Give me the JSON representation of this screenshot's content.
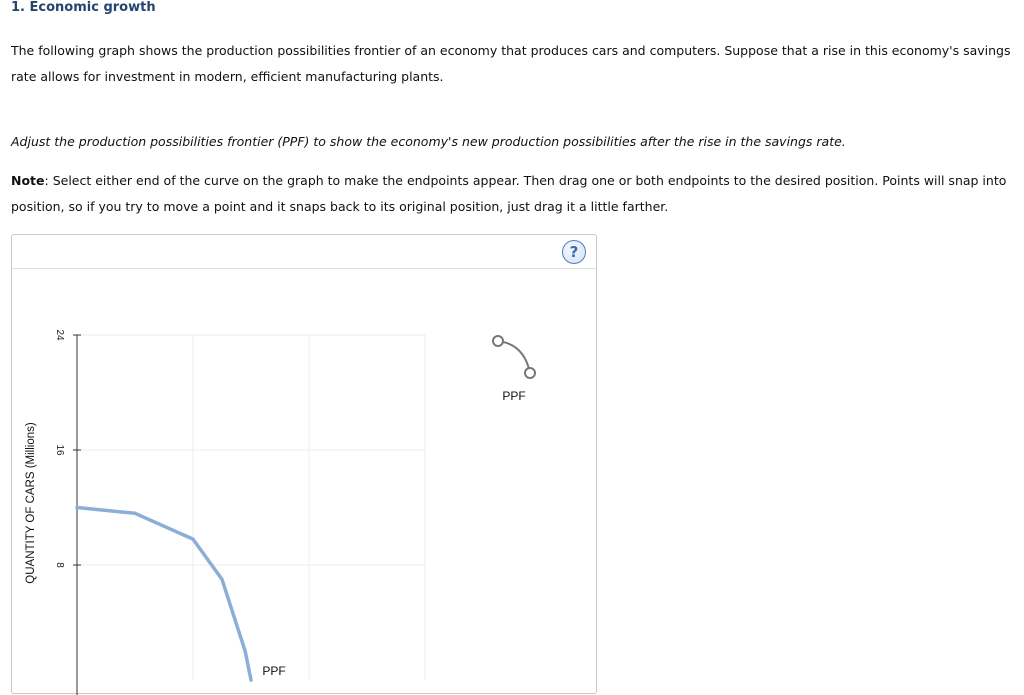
{
  "question": {
    "title": "1. Economic growth",
    "paragraph1": "The following graph shows the production possibilities frontier of an economy that produces cars and computers. Suppose that a rise in this economy's savings rate allows for investment in modern, efficient manufacturing plants.",
    "instruction": "Adjust the production possibilities frontier (PPF) to show the economy's new production possibilities after the rise in the savings rate.",
    "note_label": "Note",
    "note_text": ": Select either end of the curve on the graph to make the endpoints appear. Then drag one or both endpoints to the desired position. Points will snap into position, so if you try to move a point and it snaps back to its original position, just drag it a little farther."
  },
  "graph": {
    "help_label": "?",
    "tool_label": "PPF",
    "curve_label": "PPF",
    "curve_color": "#8aaed6",
    "tool_color": "#777777",
    "chart_data": {
      "type": "line",
      "ylabel": "QUANTITY OF CARS (Millions)",
      "xlabel": "",
      "y_ticks": [
        8,
        16,
        24
      ],
      "ylim": [
        0,
        24
      ],
      "xlim": [
        0,
        24
      ],
      "x_gridlines": [
        8,
        16,
        24
      ],
      "grid": true,
      "series": [
        {
          "x": [
            0,
            4,
            8,
            10,
            11.6,
            12
          ],
          "y": [
            12,
            11.6,
            9.8,
            7,
            2,
            0
          ]
        }
      ]
    }
  }
}
